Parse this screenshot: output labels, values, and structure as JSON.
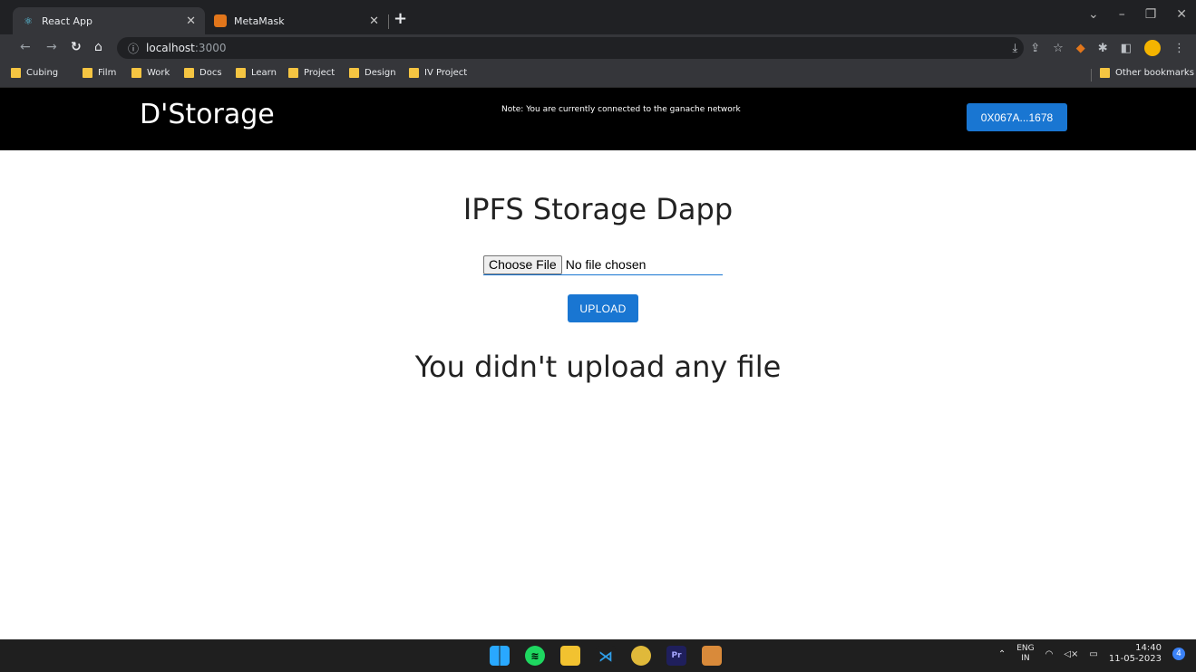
{
  "browser": {
    "tabs": [
      {
        "title": "React App",
        "icon": "react-icon",
        "active": true
      },
      {
        "title": "MetaMask",
        "icon": "metamask-fox-icon",
        "active": false
      }
    ],
    "address": {
      "host": "localhost",
      "port": ":3000"
    },
    "bookmarks": [
      "Cubing",
      "Film",
      "Work",
      "Docs",
      "Learn",
      "Project",
      "Design",
      "IV Project"
    ],
    "other_bookmarks": "Other bookmarks"
  },
  "app": {
    "brand": "D'Storage",
    "network_note": "Note: You are currently connected to the ganache network",
    "wallet_address": "0X067A...1678",
    "heading": "IPFS Storage Dapp",
    "choose_file_label": "Choose File",
    "file_status": "No file chosen",
    "upload_label": "UPLOAD",
    "empty_message": "You didn't upload any file"
  },
  "taskbar": {
    "lang_top": "ENG",
    "lang_bottom": "IN",
    "time": "14:40",
    "date": "11-05-2023",
    "notification_count": "4"
  },
  "colors": {
    "primary": "#1976d2",
    "navbar": "#000000",
    "chrome_dark": "#202124",
    "chrome_mid": "#35363a"
  }
}
